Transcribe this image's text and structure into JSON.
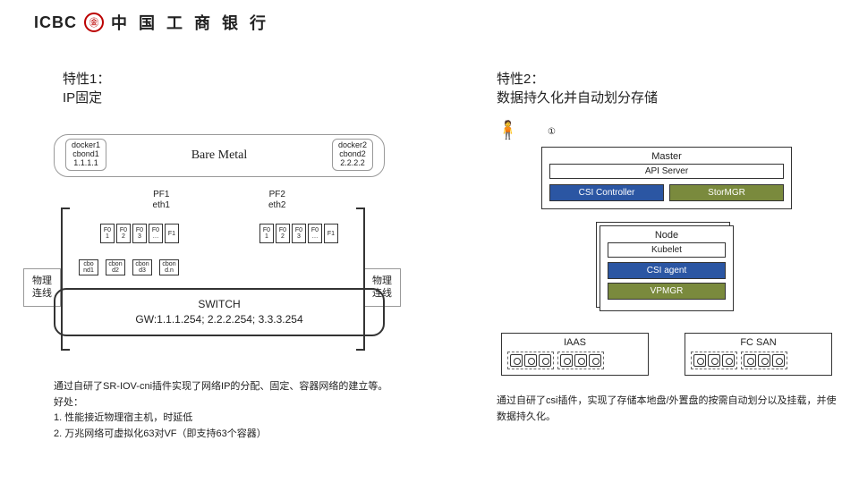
{
  "header": {
    "brand": "ICBC",
    "logo_glyph": "●",
    "bank_name": "中 国 工 商 银 行"
  },
  "feature1": {
    "line1": "特性1：",
    "line2": "IP固定"
  },
  "feature2": {
    "line1": "特性2：",
    "line2": "数据持久化并自动划分存储"
  },
  "left": {
    "bare_metal": "Bare Metal",
    "docker1": {
      "a": "docker1",
      "b": "cbond1",
      "c": "1.1.1.1"
    },
    "docker2": {
      "a": "docker2",
      "b": "cbond2",
      "c": "2.2.2.2"
    },
    "pf1": {
      "a": "PF1",
      "b": "eth1"
    },
    "pf2": {
      "a": "PF2",
      "b": "eth2"
    },
    "vf_labels": [
      "F0",
      "F0",
      "F0",
      "F0",
      "F1",
      "F0",
      "F0",
      "F0",
      "F0",
      "F1"
    ],
    "vf_nums": [
      "1",
      "2",
      "3",
      "…",
      "",
      "1",
      "2",
      "3",
      "…",
      ""
    ],
    "cbonds": [
      "cbo\nnd1",
      "cbon\nd2",
      "cbon\nd3",
      "cbon\nd.n"
    ],
    "switch_title": "SWITCH",
    "switch_gw": "GW:1.1.1.254;  2.2.2.254;  3.3.3.254",
    "side_label": "物理连线"
  },
  "right": {
    "master": "Master",
    "api": "API Server",
    "csi_ctrl": "CSI Controller",
    "stormgr": "StorMGR",
    "node": "Node",
    "kubelet": "Kubelet",
    "csi_agent": "CSI agent",
    "vpmgr": "VPMGR",
    "iaas": "IAAS",
    "fcsan": "FC SAN",
    "step1": "①"
  },
  "desc1": {
    "l1": "通过自研了SR-IOV-cni插件实现了网络IP的分配、固定、容器网络的建立等。",
    "l2": "好处：",
    "l3": "1. 性能接近物理宿主机，时延低",
    "l4": "2. 万兆网络可虚拟化63对VF（即支持63个容器）"
  },
  "desc2": {
    "l1": "通过自研了csi插件，实现了存储本地盘/外置盘的按需自动划分以及挂载，并使数据持久化。"
  }
}
